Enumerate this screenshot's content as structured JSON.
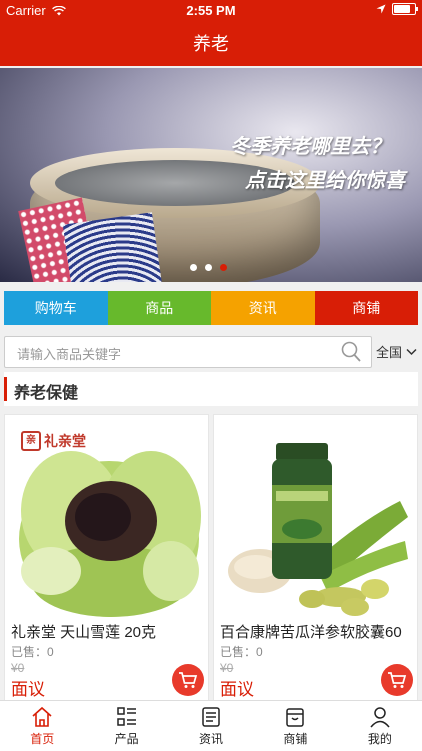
{
  "status": {
    "carrier": "Carrier",
    "time": "2:55 PM",
    "battery_level": 0.9
  },
  "navbar": {
    "title": "养老"
  },
  "banner": {
    "headline": "冬季养老哪里去？",
    "subline": "点击这里给你惊喜",
    "active_slide": 3
  },
  "categories": [
    {
      "label": "购物车",
      "color": "#1ea0dc"
    },
    {
      "label": "商品",
      "color": "#67b92c"
    },
    {
      "label": "资讯",
      "color": "#f5a200"
    },
    {
      "label": "商铺",
      "color": "#d81e06"
    }
  ],
  "search": {
    "placeholder": "请输入商品关键字",
    "region": "全国"
  },
  "section": {
    "title": "养老保健"
  },
  "products": [
    {
      "name": "礼亲堂 天山雪莲 20克",
      "sold": "已售：0",
      "price": "¥0",
      "negotiable": "面议",
      "brand": "礼亲堂"
    },
    {
      "name": "百合康牌苦瓜洋参软胶囊60",
      "sold": "已售：0",
      "price": "¥0",
      "negotiable": "面议"
    }
  ],
  "tabs": [
    {
      "label": "首页",
      "icon": "home-icon"
    },
    {
      "label": "产品",
      "icon": "grid-list-icon"
    },
    {
      "label": "资讯",
      "icon": "news-icon"
    },
    {
      "label": "商铺",
      "icon": "store-icon"
    },
    {
      "label": "我的",
      "icon": "person-icon"
    }
  ],
  "colors": {
    "brand": "#d81e06",
    "cart_button": "#e83a2b"
  }
}
